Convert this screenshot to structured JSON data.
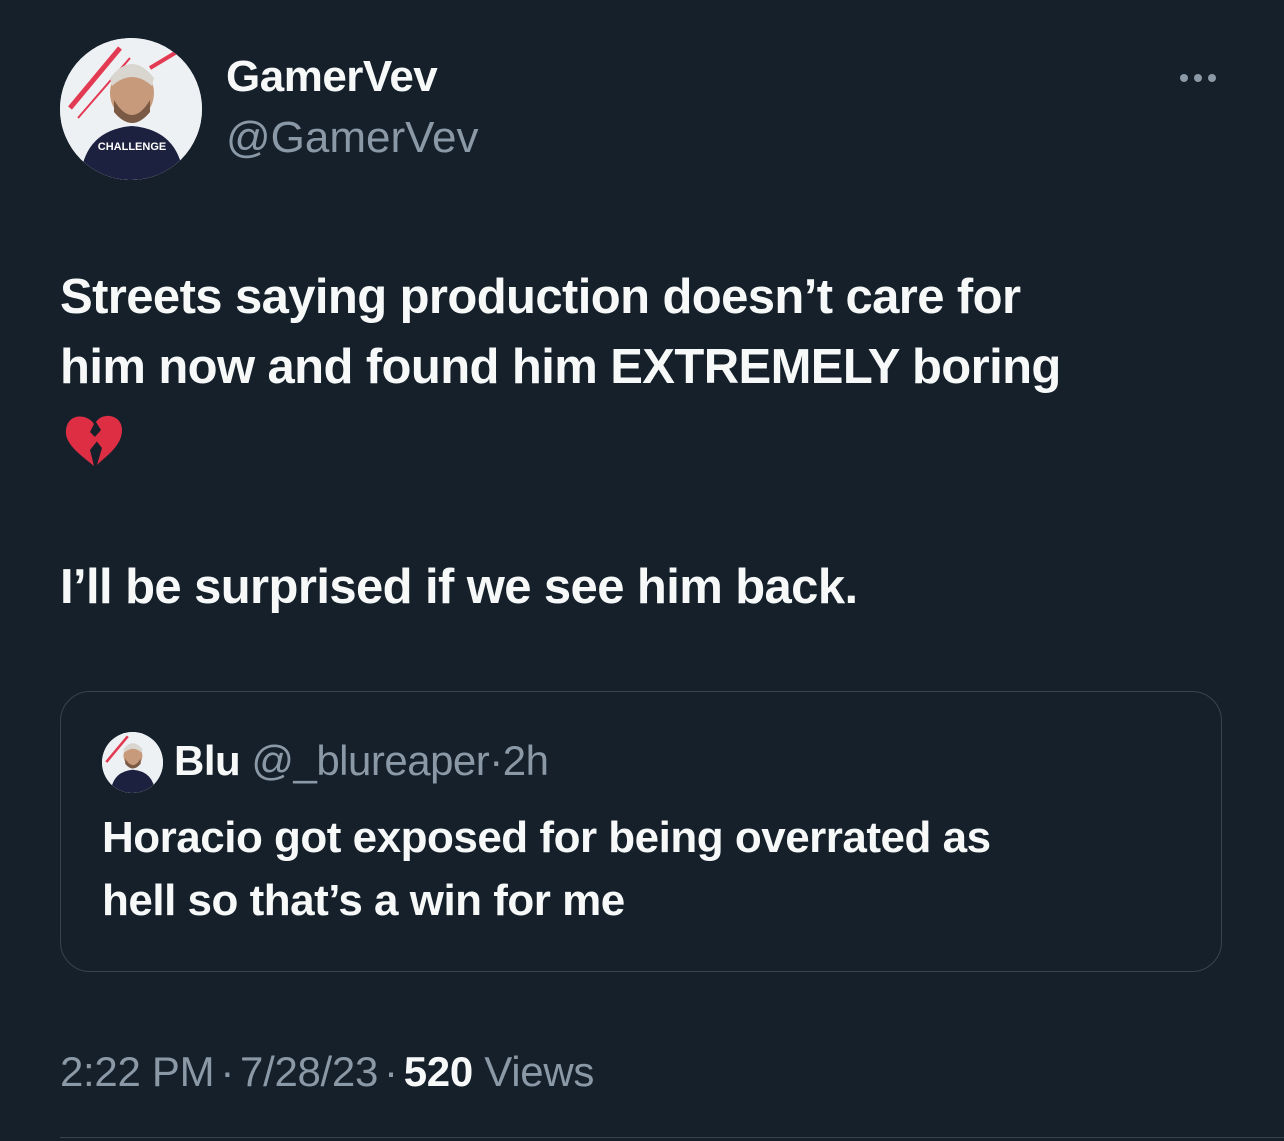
{
  "author": {
    "name": "GamerVev",
    "handle": "@GamerVev",
    "avatar_badge": "CHALLENGE"
  },
  "more_icon": "more-horizontal-icon",
  "tweet": {
    "line1": "Streets saying production doesn’t care for",
    "line2": "him now and found him EXTREMELY boring",
    "emoji": "broken-heart-icon",
    "line3": "I’ll be surprised if we see him back."
  },
  "quote": {
    "name": "Blu",
    "handle": "@_blureaper",
    "separator": "·",
    "time": "2h",
    "line1": "Horacio got exposed for being overrated as",
    "line2": "hell so that’s a win for me"
  },
  "meta": {
    "time": "2:22 PM",
    "separator": "·",
    "date": "7/28/23",
    "views_count": "520",
    "views_label": "Views"
  },
  "colors": {
    "background": "#15202b",
    "text_primary": "#f7f9f9",
    "text_secondary": "#8b98a5",
    "border": "#38444d",
    "heart_red": "#dd2e44"
  }
}
